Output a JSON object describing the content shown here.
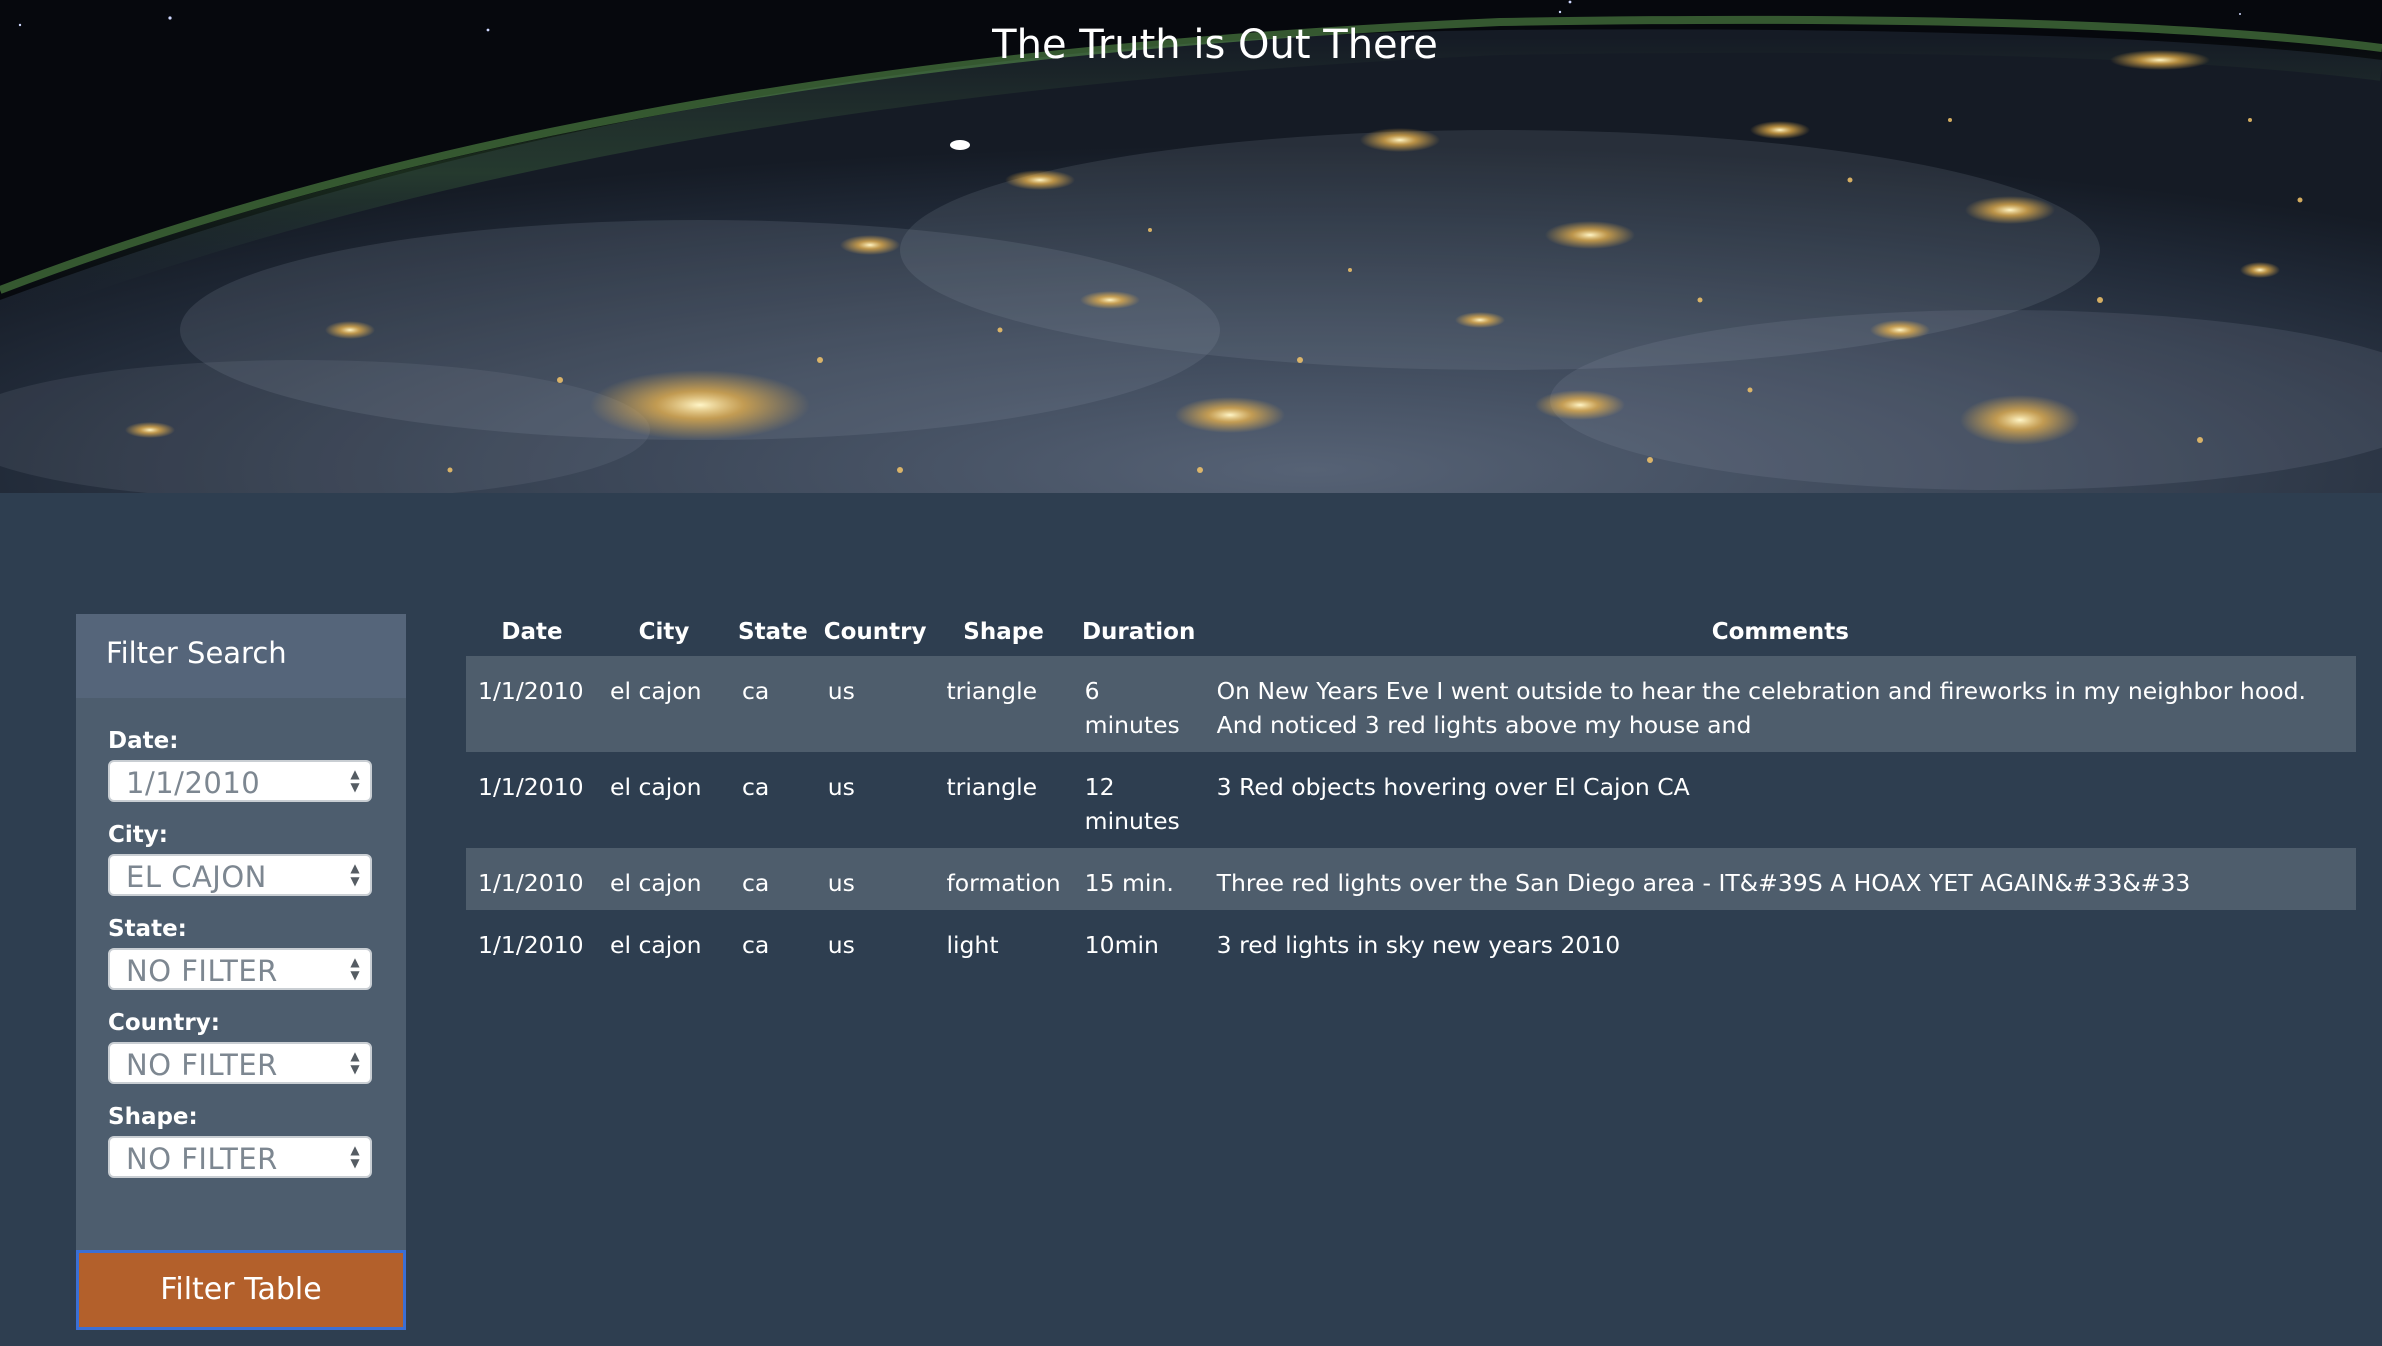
{
  "hero": {
    "title": "The Truth is Out There"
  },
  "filter": {
    "heading": "Filter Search",
    "fields": [
      {
        "label": "Date:",
        "value": "1/1/2010"
      },
      {
        "label": "City:",
        "value": "EL CAJON"
      },
      {
        "label": "State:",
        "value": "NO FILTER"
      },
      {
        "label": "Country:",
        "value": "NO FILTER"
      },
      {
        "label": "Shape:",
        "value": "NO FILTER"
      }
    ],
    "button_label": "Filter Table"
  },
  "table": {
    "headers": [
      "Date",
      "City",
      "State",
      "Country",
      "Shape",
      "Duration",
      "Comments"
    ],
    "rows": [
      [
        "1/1/2010",
        "el cajon",
        "ca",
        "us",
        "triangle",
        "6 minutes",
        "On New Years Eve I went outside to hear the celebration and fireworks in my neighbor hood. And noticed 3 red lights above my house and"
      ],
      [
        "1/1/2010",
        "el cajon",
        "ca",
        "us",
        "triangle",
        "12 minutes",
        "3 Red objects hovering over El Cajon CA"
      ],
      [
        "1/1/2010",
        "el cajon",
        "ca",
        "us",
        "formation",
        "15 min.",
        "Three red lights over the San Diego area - IT&#39S A HOAX YET AGAIN&#33&#33"
      ],
      [
        "1/1/2010",
        "el cajon",
        "ca",
        "us",
        "light",
        "10min",
        "3 red lights in sky new years 2010"
      ]
    ]
  },
  "colors": {
    "page_background": "#2e3e50",
    "panel_background": "#4d5d6e",
    "panel_header": "#55657a",
    "button_background": "#b3602b",
    "button_border": "#3b6fd4",
    "row_stripe": "#4e5d6c"
  }
}
